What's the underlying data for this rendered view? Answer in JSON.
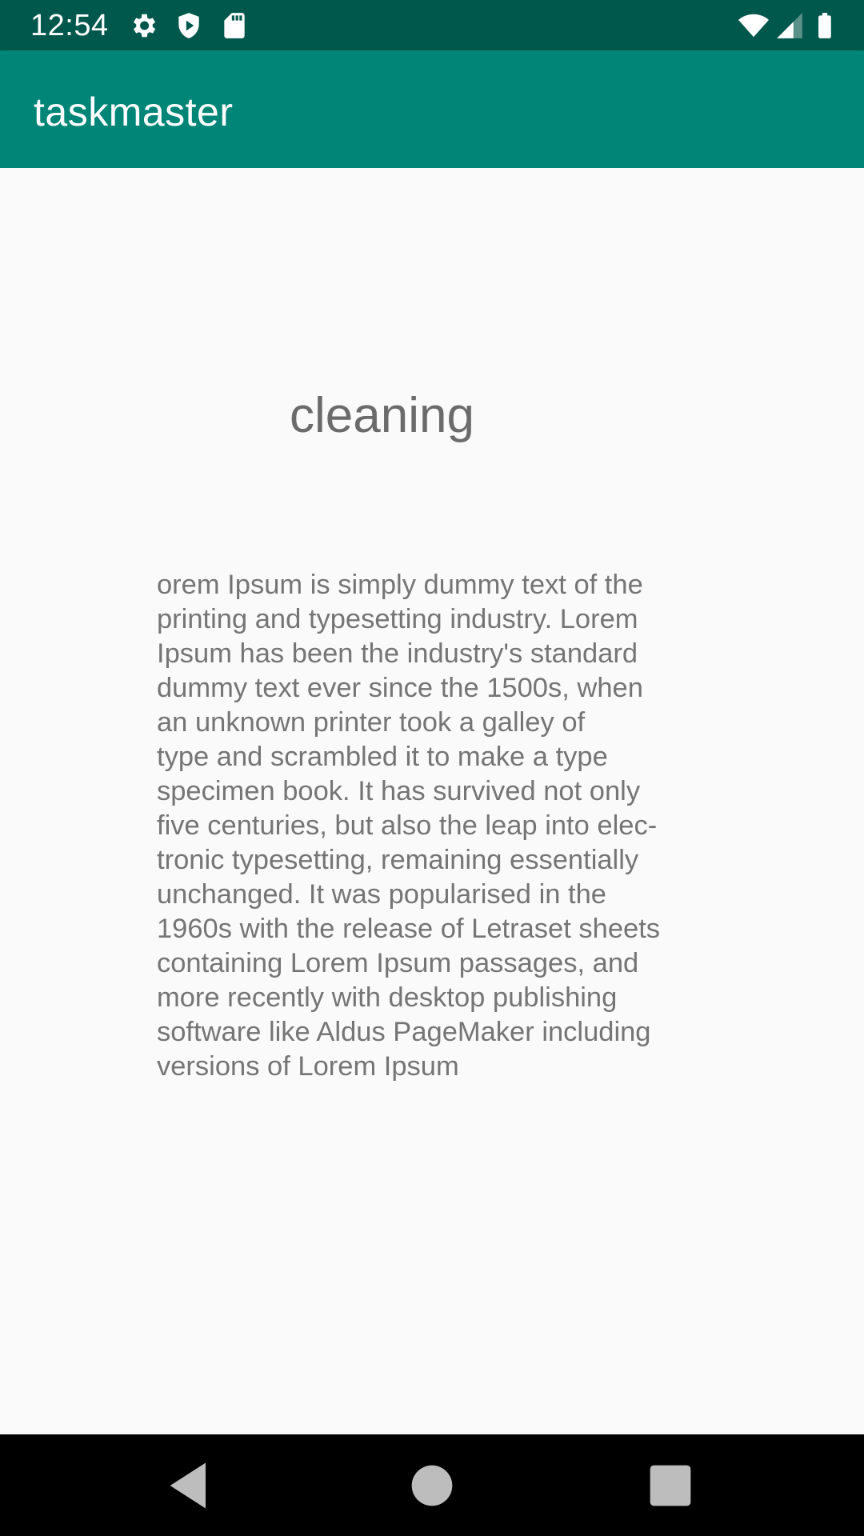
{
  "status_bar": {
    "time": "12:54",
    "icons_left": [
      "gear-icon",
      "shield-icon",
      "sd-card-icon"
    ],
    "icons_right": [
      "wifi-icon",
      "signal-icon",
      "battery-icon"
    ]
  },
  "app_bar": {
    "title": "taskmaster"
  },
  "task": {
    "title": "cleaning",
    "body_lines": [
      "orem Ipsum is simply dummy text of the",
      "printing and typesetting industry. Lorem",
      "Ipsum has been the industry's standard",
      "dummy text ever since the 1500s, when",
      "an unknown printer took a galley of",
      "type and scrambled it to make a type",
      "specimen book. It has survived not only",
      "five centuries, but also the leap into elec-",
      "tronic typesetting, remaining essentially",
      "unchanged. It was popularised in the",
      "1960s with the release of Letraset sheets",
      "containing Lorem Ipsum passages, and",
      "more recently with desktop publishing",
      "software like Aldus PageMaker including",
      "versions of Lorem Ipsum"
    ]
  },
  "nav_bar": {
    "buttons": [
      "back-icon",
      "home-icon",
      "recents-icon"
    ]
  },
  "colors": {
    "status_bar": "#00574b",
    "app_bar": "#008577",
    "background": "#fafafa",
    "text": "#757575"
  }
}
